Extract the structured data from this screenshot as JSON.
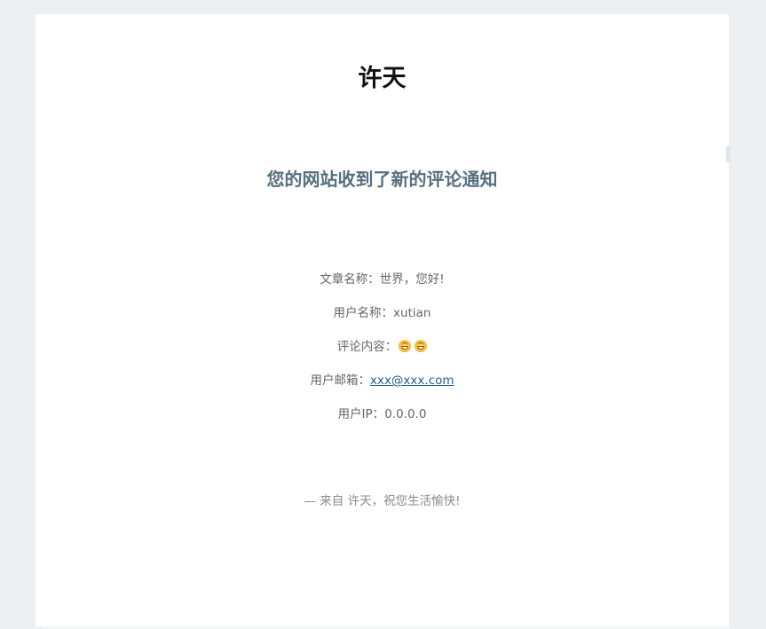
{
  "header": {
    "site_name": "许天",
    "notice_title": "您的网站收到了新的评论通知"
  },
  "details": {
    "article_label": "文章名称：",
    "article_value": "世界，您好!",
    "user_label": "用户名称：",
    "user_value": "xutian",
    "content_label": "评论内容：",
    "content_emojis": [
      "grinning-face-emoji",
      "grinning-face-emoji"
    ],
    "email_label": "用户邮箱：",
    "email_value": "xxx@xxx.com",
    "ip_label": "用户IP：",
    "ip_value": "0.0.0.0"
  },
  "footer": {
    "signature": "— 来自 许天，祝您生活愉快!"
  },
  "colors": {
    "background": "#ecf0f3",
    "card": "#ffffff",
    "notice_title": "#56707f",
    "text": "#666666",
    "link": "#1f5f8b",
    "footer": "#8a8a8a"
  }
}
